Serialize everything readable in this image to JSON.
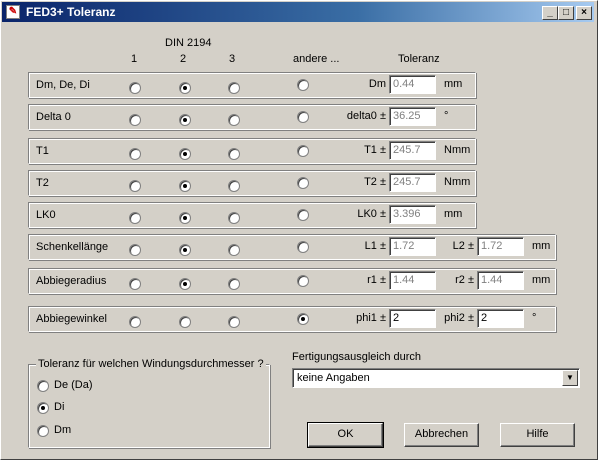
{
  "window": {
    "title": "FED3+ Toleranz",
    "minimize": "_",
    "maximize": "□",
    "close": "×"
  },
  "header": {
    "din": "DIN 2194",
    "col1": "1",
    "col2": "2",
    "col3": "3",
    "other": "andere ...",
    "tolerance": "Toleranz"
  },
  "rows": [
    {
      "label": "Dm, De, Di",
      "selected": 2,
      "field1_label": "Dm",
      "field1_value": "0.44",
      "unit": "mm"
    },
    {
      "label": "Delta 0",
      "selected": 2,
      "field1_label": "delta0 ±",
      "field1_value": "36.25",
      "unit": "°"
    },
    {
      "label": "T1",
      "selected": 2,
      "field1_label": "T1 ±",
      "field1_value": "245.7",
      "unit": "Nmm"
    },
    {
      "label": "T2",
      "selected": 2,
      "field1_label": "T2 ±",
      "field1_value": "245.7",
      "unit": "Nmm"
    },
    {
      "label": "LK0",
      "selected": 2,
      "field1_label": "LK0 ±",
      "field1_value": "3.396",
      "unit": "mm"
    },
    {
      "label": "Schenkellänge",
      "selected": 2,
      "field1_label": "L1 ±",
      "field1_value": "1.72",
      "field2_label": "L2 ±",
      "field2_value": "1.72",
      "unit": "mm"
    },
    {
      "label": "Abbiegeradius",
      "selected": 2,
      "field1_label": "r1 ±",
      "field1_value": "1.44",
      "field2_label": "r2 ±",
      "field2_value": "1.44",
      "unit": "mm"
    },
    {
      "label": "Abbiegewinkel",
      "selected": 4,
      "field1_label": "phi1 ±",
      "field1_value": "2",
      "field2_label": "phi2 ±",
      "field2_value": "2",
      "unit": "°"
    }
  ],
  "diameter_group": {
    "title": "Toleranz für welchen Windungsdurchmesser ?",
    "options": [
      "De (Da)",
      "Di",
      "Dm"
    ],
    "selected": 2
  },
  "fertigung": {
    "label": "Fertigungsausgleich durch",
    "value": "keine Angaben"
  },
  "buttons": {
    "ok": "OK",
    "cancel": "Abbrechen",
    "help": "Hilfe"
  }
}
